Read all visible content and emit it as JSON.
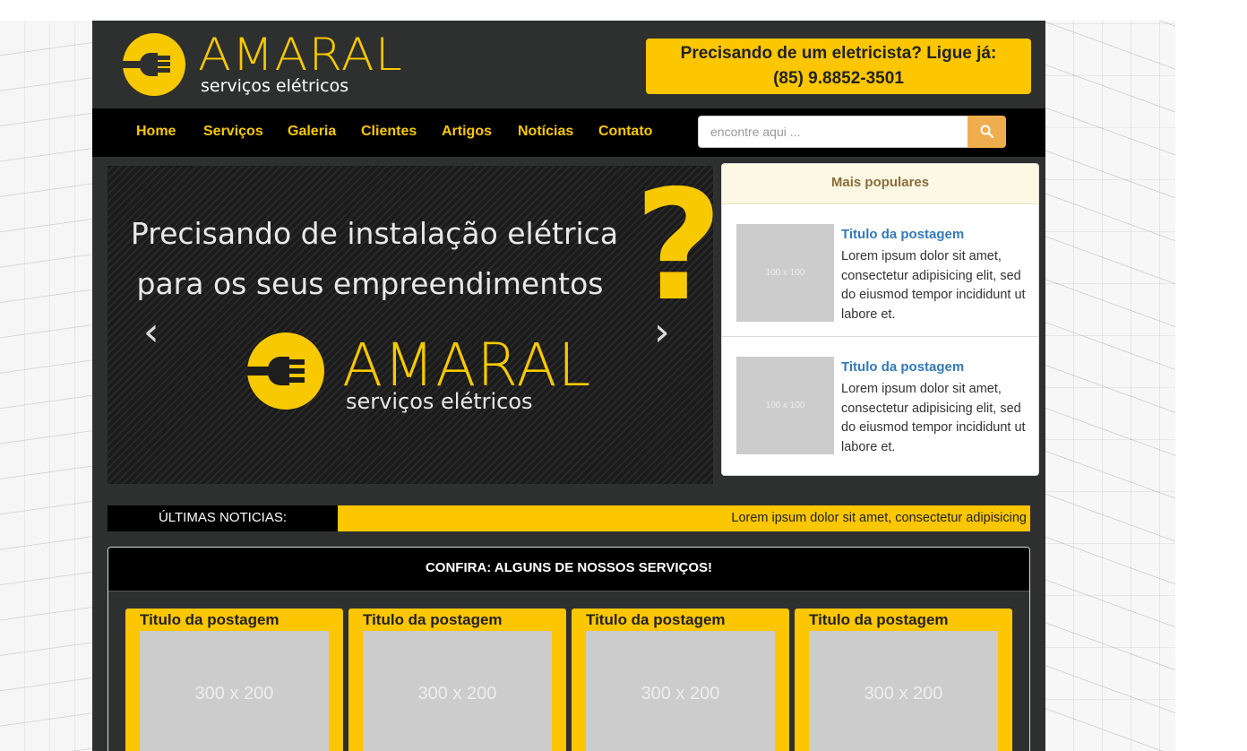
{
  "brand": {
    "name": "AMARAL",
    "tagline": "serviços elétricos",
    "accent_color": "#f8c900",
    "logo_icon": "plug-icon"
  },
  "header": {
    "call_line1": "Precisando de um eletricista? Ligue já:",
    "call_line2": "(85) 9.8852-3501"
  },
  "nav": {
    "items": [
      {
        "label": "Home"
      },
      {
        "label": "Serviços"
      },
      {
        "label": "Galeria"
      },
      {
        "label": "Clientes"
      },
      {
        "label": "Artigos"
      },
      {
        "label": "Notícias"
      },
      {
        "label": "Contato"
      }
    ],
    "search_placeholder": "encontre aqui ...",
    "search_icon": "search-icon"
  },
  "carousel": {
    "line1": "Precisando de instalação elétrica",
    "line2": "para os seus empreendimentos",
    "question_mark": "?",
    "logo_text": "AMARAL",
    "logo_sub": "serviços elétricos",
    "prev_glyph": "‹",
    "next_glyph": "›"
  },
  "popular": {
    "heading": "Mais populares",
    "posts": [
      {
        "thumb": "100 x 100",
        "title": "Titulo da postagem",
        "text": "Lorem ipsum dolor sit amet, consectetur adipisicing elit, sed do eiusmod tempor incididunt ut labore et."
      },
      {
        "thumb": "100 x 100",
        "title": "Titulo da postagem",
        "text": "Lorem ipsum dolor sit amet, consectetur adipisicing elit, sed do eiusmod tempor incididunt ut labore et."
      }
    ]
  },
  "ticker": {
    "label": "ÚLTIMAS NOTICIAS:",
    "text": "Lorem ipsum dolor sit amet, consectetur adipisicing"
  },
  "services": {
    "heading": "CONFIRA: ALGUNS DE NOSSOS SERVIÇOS!",
    "cards": [
      {
        "title": "Titulo da postagem",
        "image": "300 x 200"
      },
      {
        "title": "Titulo da postagem",
        "image": "300 x 200"
      },
      {
        "title": "Titulo da postagem",
        "image": "300 x 200"
      },
      {
        "title": "Titulo da postagem",
        "image": "300 x 200"
      }
    ]
  }
}
